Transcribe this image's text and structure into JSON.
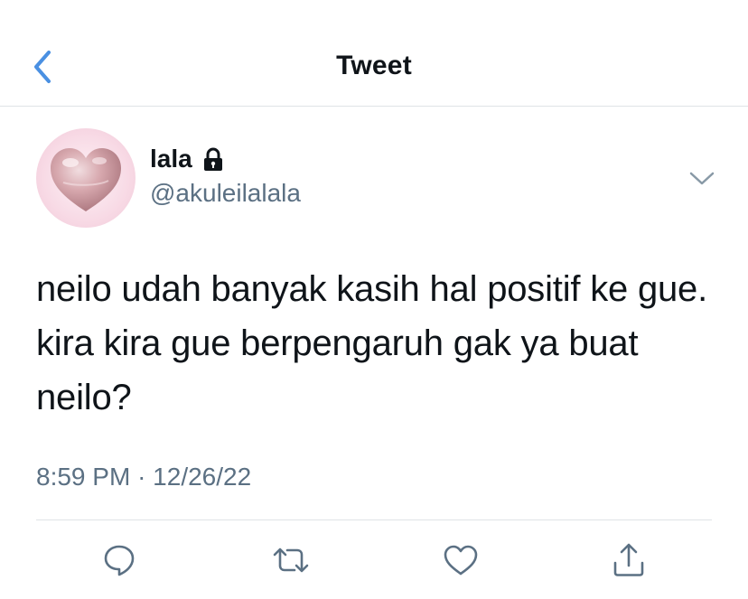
{
  "header": {
    "title": "Tweet"
  },
  "tweet": {
    "display_name": "lala",
    "handle": "@akuleilalala",
    "text": "neilo udah banyak kasih hal positif ke gue. kira kira gue berpengaruh gak ya buat neilo?",
    "time": "8:59 PM",
    "separator": "·",
    "date": "12/26/22",
    "protected": true
  },
  "icons": {
    "back": "chevron-left-icon",
    "lock": "lock-icon",
    "caret": "chevron-down-icon",
    "reply": "reply-icon",
    "retweet": "retweet-icon",
    "like": "heart-icon",
    "share": "share-icon"
  },
  "colors": {
    "accent": "#4a90e2",
    "text": "#0f1419",
    "secondary": "#5b7083",
    "divider": "#dfe3e6"
  }
}
